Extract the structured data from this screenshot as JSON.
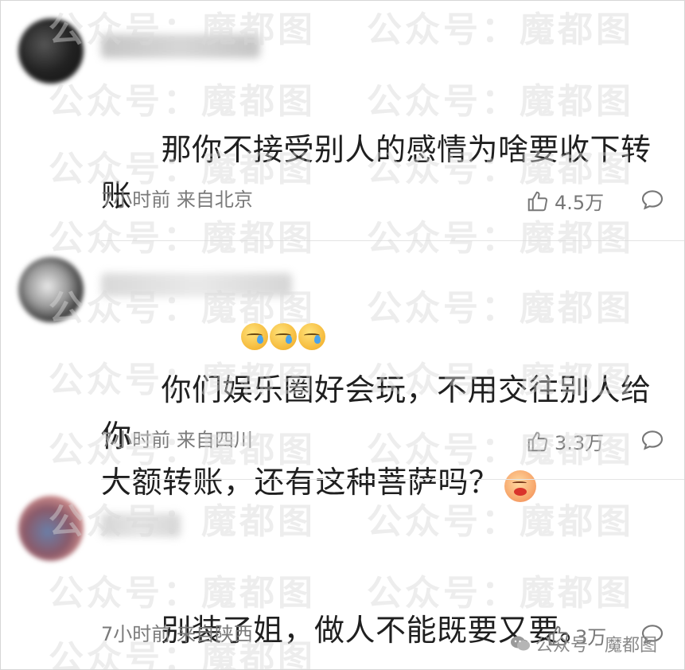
{
  "comments": [
    {
      "text": "那你不接受别人的感情为啥要收下转账",
      "emojis": [
        "sweat-emoji",
        "sweat-emoji",
        "sweat-emoji"
      ],
      "time": "7小时前",
      "location": "来自北京",
      "likes": "4.5万"
    },
    {
      "text": "你们娱乐圈好会玩，不用交往别人给你\n大额转账，还有这种菩萨吗？",
      "emojis": [
        "kiss-emoji"
      ],
      "time": "7小时前",
      "location": "来自四川",
      "likes": "3.3万"
    },
    {
      "text": "别装了姐，做人不能既要又要。",
      "emojis": [],
      "time": "7小时前",
      "location": "来自陕西",
      "likes": "3万"
    }
  ],
  "watermark": {
    "text": "公众号：魔都图",
    "bottom_text": "公众号 · 魔都图"
  },
  "colors": {
    "text": "#1f1f1f",
    "meta": "#7a7a7a",
    "watermark": "#d9d9d9"
  }
}
